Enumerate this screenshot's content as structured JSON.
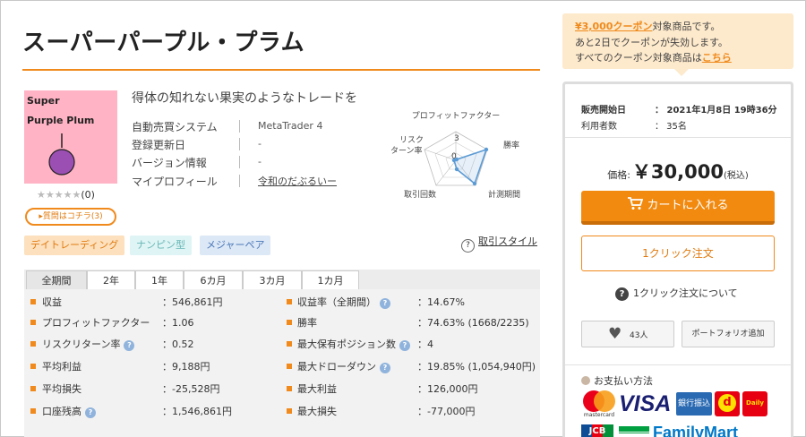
{
  "product": {
    "title": "スーパーパープル・プラム",
    "image_text_line1": "Super",
    "image_text_line2": "Purple Plum",
    "rating_stars": "★★★★★",
    "rating_count": "(0)",
    "qa_button": "▸質問はコチラ(3)",
    "subtitle": "得体の知れない果実のようなトレードを"
  },
  "info": [
    {
      "label": "自動売買システム",
      "value": "MetaTrader 4"
    },
    {
      "label": "登録更新日",
      "value": "-"
    },
    {
      "label": "バージョン情報",
      "value": "-"
    },
    {
      "label": "マイプロフィール",
      "value": "令和のだぶるいー"
    }
  ],
  "radar": {
    "labels": {
      "top": "プロフィットファクター",
      "top_right": "勝率",
      "bottom_right": "計測期間",
      "bottom_left": "取引回数",
      "top_left_1": "リスク",
      "top_left_2": "ターン率"
    },
    "scale_label": "3",
    "scale_label_0": "0",
    "line_color": "#5b9bd5"
  },
  "tags": [
    "デイトレーディング",
    "ナンピン型",
    "メジャーペア"
  ],
  "trade_style": {
    "icon": "?",
    "label": "取引スタイル"
  },
  "tabs": [
    "全期間",
    "2年",
    "1年",
    "6カ月",
    "3カ月",
    "1カ月"
  ],
  "stats_left": [
    {
      "label": "収益",
      "value": "：546,861円",
      "help": false
    },
    {
      "label": "プロフィットファクター",
      "value": "：1.06",
      "help": false
    },
    {
      "label": "リスクリターン率",
      "value": "：0.52",
      "help": true
    },
    {
      "label": "平均利益",
      "value": "：9,188円",
      "help": false
    },
    {
      "label": "平均損失",
      "value": "：-25,528円",
      "help": false
    },
    {
      "label": "口座残高",
      "value": "：1,546,861円",
      "help": true
    }
  ],
  "stats_right": [
    {
      "label": "収益率（全期間）",
      "value": "：14.67%",
      "help": true
    },
    {
      "label": "勝率",
      "value": "：74.63% (1668/2235)",
      "help": false
    },
    {
      "label": "最大保有ポジション数",
      "value": "：4",
      "help": true
    },
    {
      "label": "最大ドローダウン",
      "value": "：19.85% (1,054,940円)",
      "help": true
    },
    {
      "label": "最大利益",
      "value": "：126,000円",
      "help": false
    },
    {
      "label": "最大損失",
      "value": "：-77,000円",
      "help": false
    }
  ],
  "help_icon": "?",
  "coupon": {
    "link1": "¥3,000クーポン",
    "line1_rest": "対象商品です。",
    "line2": "あと2日でクーポンが失効します。",
    "line3_prefix": "すべてのクーポン対象商品は",
    "link2": "こちら"
  },
  "sale": {
    "start_label": "販売開始日",
    "start_value": "：  2021年1月8日  19時36分",
    "users_label": "利用者数",
    "users_value": "：  35名"
  },
  "price": {
    "label": "価格:",
    "value": "￥30,000",
    "tax": "(税込)"
  },
  "buttons": {
    "cart": "カートに入れる",
    "one_click": "1クリック注文",
    "one_click_help": "1クリック注文について",
    "favorite_count": "43人",
    "portfolio": "ポートフォリオ追加"
  },
  "payment": {
    "title": "お支払い方法",
    "mastercard_text": "mastercard",
    "visa_text": "VISA",
    "bank_text": "銀行振込",
    "d_text": "d",
    "daily_text": "Daily",
    "jcb_text": "JCB",
    "familymart_text": "FamilyMart"
  },
  "colors": {
    "accent": "#f08a1c",
    "cart_button": "#f28a10",
    "coupon_bg": "#fde9cb",
    "stats_bg": "#f2f2f2"
  }
}
